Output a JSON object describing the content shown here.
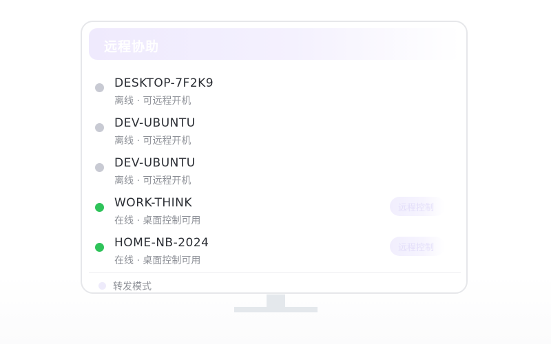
{
  "panel": {
    "title": "远程协助"
  },
  "devices": [
    {
      "name": "DESKTOP-7F2K9",
      "status": "离线 · 可远程开机",
      "online": false,
      "action": ""
    },
    {
      "name": "DEV-UBUNTU",
      "status": "离线 · 可远程开机",
      "online": false,
      "action": ""
    },
    {
      "name": "DEV-UBUNTU",
      "status": "离线 · 可远程开机",
      "online": false,
      "action": ""
    },
    {
      "name": "WORK-THINK",
      "status": "在线 · 桌面控制可用",
      "online": true,
      "action": "远程控制"
    },
    {
      "name": "HOME-NB-2024",
      "status": "在线 · 桌面控制可用",
      "online": true,
      "action": "远程控制"
    }
  ],
  "footer": {
    "label": "转发模式"
  },
  "colors": {
    "online": "#2fc35a",
    "offline": "#c8cad3",
    "accent": "#efeafd"
  }
}
